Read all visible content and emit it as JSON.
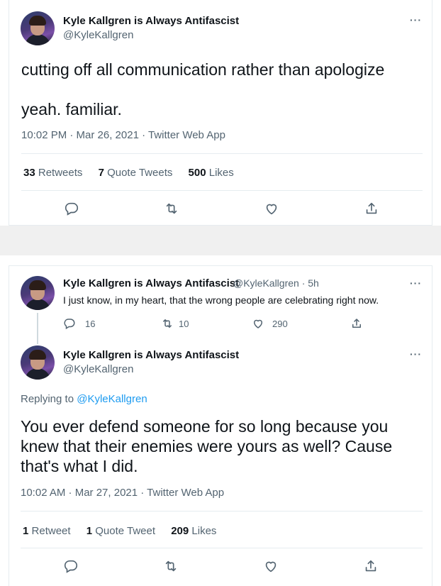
{
  "tweet1": {
    "display_name": "Kyle Kallgren is Always Antifascist",
    "handle": "@KyleKallgren",
    "line1": "cutting off all communication rather than apologize",
    "line2": "yeah. familiar.",
    "timestamp": "10:02 PM · Mar 26, 2021 · Twitter Web App",
    "retweets_count": "33",
    "retweets_label": "Retweets",
    "quotes_count": "7",
    "quotes_label": "Quote Tweets",
    "likes_count": "500",
    "likes_label": "Likes",
    "more": "···"
  },
  "thread_parent": {
    "display_name": "Kyle Kallgren is Always Antifascist",
    "handle_time": "@KyleKallgren · 5h",
    "text": "I just know, in my heart, that the wrong people are celebrating right now.",
    "reply_count": "16",
    "retweet_count": "10",
    "like_count": "290",
    "more": "···"
  },
  "tweet2": {
    "display_name": "Kyle Kallgren is Always Antifascist",
    "handle": "@KyleKallgren",
    "replying_prefix": "Replying to",
    "replying_mention": "@KyleKallgren",
    "line1": "You ever defend someone for so long because you",
    "line2": "knew that their enemies were yours as well? Cause",
    "line3": "that's what I did.",
    "timestamp": "10:02 AM · Mar 27, 2021 · Twitter Web App",
    "retweets_count": "1",
    "retweets_label": "Retweet",
    "quotes_count": "1",
    "quotes_label": "Quote Tweet",
    "likes_count": "209",
    "likes_label": "Likes",
    "more": "···"
  },
  "icons": [
    "reply-icon",
    "retweet-icon",
    "like-icon",
    "share-icon"
  ],
  "colors": {
    "text": "#0f1419",
    "muted": "#536471",
    "link": "#1d9bf0",
    "border": "#e6ecf0"
  }
}
